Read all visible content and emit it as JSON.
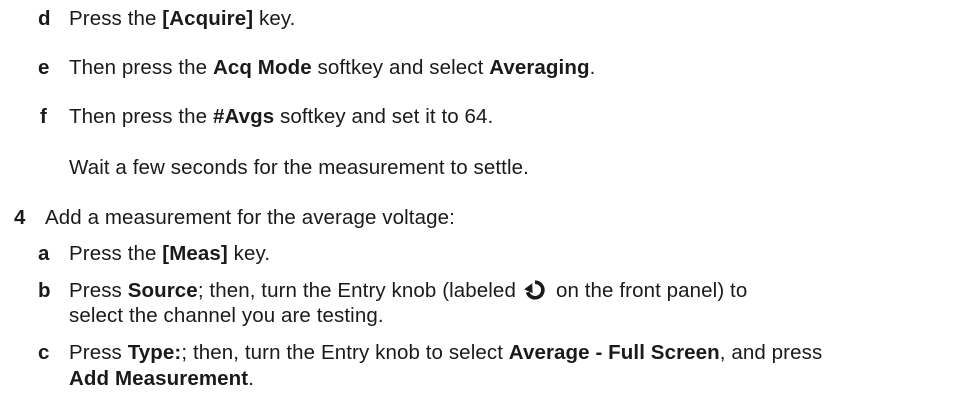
{
  "steps": {
    "d": {
      "marker": "d",
      "t1": "Press the ",
      "b1": "[Acquire]",
      "t2": " key."
    },
    "e": {
      "marker": "e",
      "t1": "Then press the ",
      "b1": "Acq Mode",
      "t2": " softkey and select ",
      "b2": "Averaging",
      "t3": "."
    },
    "f": {
      "marker": "f",
      "t1": "Then press the ",
      "b1": "#Avgs",
      "t2": " softkey and set it to 64."
    },
    "note": "Wait a few seconds for the measurement to settle.",
    "step4": {
      "marker": "4",
      "text": "Add a measurement for the average voltage:"
    },
    "a": {
      "marker": "a",
      "t1": "Press the ",
      "b1": "[Meas]",
      "t2": " key."
    },
    "b": {
      "marker": "b",
      "t1": "Press ",
      "b1": "Source",
      "t2": "; then, turn the Entry knob (labeled",
      "t3": "on the front panel) to",
      "l2": "select the channel you are testing."
    },
    "c": {
      "marker": "c",
      "t1": "Press ",
      "b1": "Type:",
      "t2": "; then, turn the Entry knob to select ",
      "b2": "Average - Full Screen",
      "t3": ", and press",
      "b3": "Add Measurement",
      "t4": "."
    }
  },
  "icons": {
    "knob": "entry-knob-icon"
  },
  "colors": {
    "text": "#1a1a1a"
  }
}
